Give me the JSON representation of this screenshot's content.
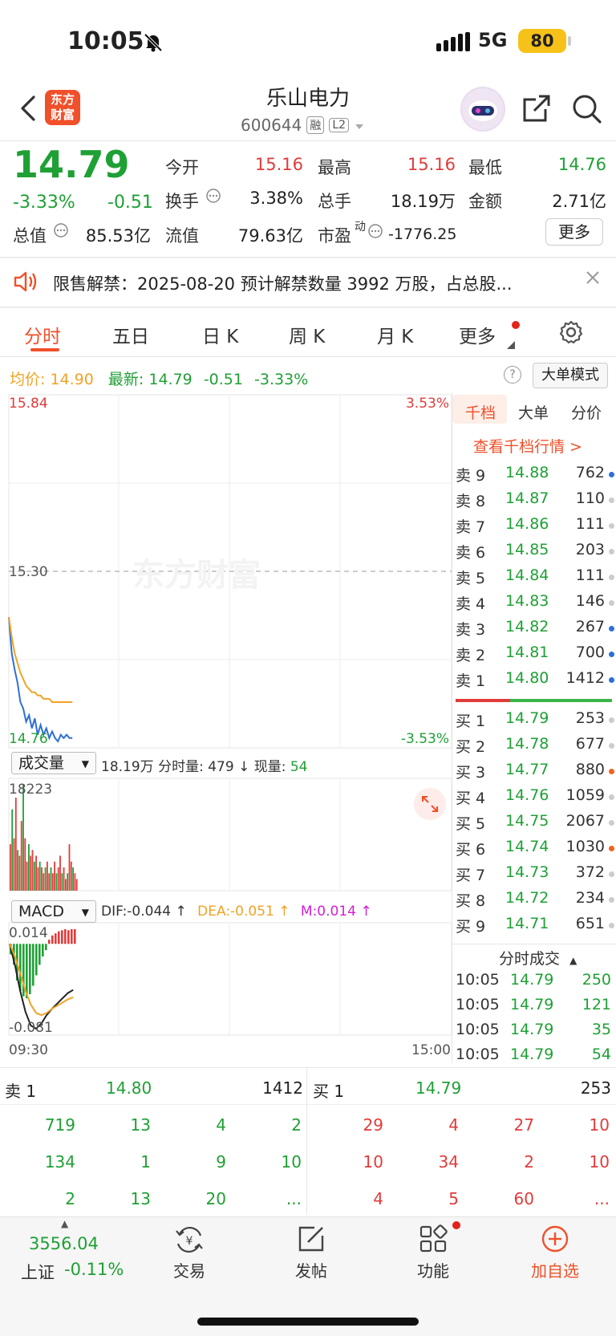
{
  "status_bar": {
    "time": "10:05",
    "network": "5G",
    "battery": "80"
  },
  "header": {
    "logo_line1": "东方",
    "logo_line2": "财富",
    "title": "乐山电力",
    "code": "600644",
    "tag_margin": "融",
    "tag_level": "L2"
  },
  "quote": {
    "price": "14.79",
    "pct": "-3.33%",
    "change": "-0.51",
    "open_label": "今开",
    "open": "15.16",
    "high_label": "最高",
    "high": "15.16",
    "low_label": "最低",
    "low": "14.76",
    "turnover_label": "换手",
    "turnover": "3.38%",
    "volume_label": "总手",
    "volume": "18.19万",
    "amount_label": "金额",
    "amount": "2.71亿",
    "mktcap_label": "总值",
    "mktcap": "85.53亿",
    "float_label": "流值",
    "float": "79.63亿",
    "pe_label": "市盈",
    "pe_sup": "动",
    "pe": "-1776.25",
    "more": "更多"
  },
  "notice": {
    "text": "限售解禁：2025-08-20 预计解禁数量 3992 万股，占总股..."
  },
  "tabs": [
    "分时",
    "五日",
    "日 K",
    "周 K",
    "月 K",
    "更多"
  ],
  "chart_header": {
    "avg_label": "均价:",
    "avg": "14.90",
    "latest_label": "最新:",
    "latest": "14.79",
    "latest_chg": "-0.51",
    "latest_pct": "-3.33%",
    "help": "?",
    "big_mode": "大单模式"
  },
  "chart_data": [
    {
      "type": "line",
      "panel": "分时",
      "x_start": "09:30",
      "x_end": "15:00",
      "y_max_label": "15.84",
      "y_mid_label": "15.30",
      "y_min_label": "14.76",
      "pct_max_label": "3.53%",
      "pct_min_label": "-3.53%",
      "ylim": [
        14.76,
        15.84
      ],
      "watermark": "东方财富",
      "series": [
        {
          "color": "#2f6fd6",
          "values": [
            15.16,
            15.05,
            15.0,
            14.96,
            14.9,
            14.88,
            14.84,
            14.86,
            14.82,
            14.85,
            14.8,
            14.83,
            14.8,
            14.82,
            14.79,
            14.81,
            14.79,
            14.78,
            14.8,
            14.79,
            14.8,
            14.79,
            14.79
          ]
        },
        {
          "color": "#f1a325",
          "values": [
            15.16,
            15.1,
            15.05,
            15.02,
            14.99,
            14.97,
            14.95,
            14.94,
            14.93,
            14.93,
            14.92,
            14.92,
            14.91,
            14.91,
            14.91,
            14.9,
            14.9,
            14.9,
            14.9,
            14.9,
            14.9,
            14.9,
            14.9
          ]
        }
      ]
    },
    {
      "type": "bar",
      "panel": "成交量",
      "label": "成交量",
      "summary": "18.19万 分时量: 479",
      "arrow": "↓",
      "now_label": "现量:",
      "now": "54",
      "y_max_label": "18223",
      "ylim": [
        0,
        18223
      ],
      "values": [
        8000,
        14000,
        9000,
        16000,
        7000,
        6000,
        12000,
        18223,
        9000,
        5000,
        8000,
        6000,
        7000,
        5000,
        6000,
        4000,
        5000,
        4000,
        3000,
        4000,
        5000,
        3000,
        4000,
        3000,
        5000,
        3000,
        4000,
        6000,
        3000,
        4000,
        2000,
        3000,
        8000,
        5000,
        4000,
        3000,
        2000
      ]
    },
    {
      "type": "line",
      "panel": "MACD",
      "label": "MACD",
      "dif": "DIF:-0.044 ↑",
      "dea": "DEA:-0.051 ↑",
      "m": "M:0.014 ↑",
      "y_max_label": "0.014",
      "y_min_label": "-0.081",
      "ylim": [
        -0.081,
        0.014
      ],
      "series": [
        {
          "name": "DIF",
          "color": "#222222",
          "values": [
            0.0,
            -0.02,
            -0.045,
            -0.065,
            -0.078,
            -0.081,
            -0.076,
            -0.068,
            -0.062,
            -0.057,
            -0.052,
            -0.047,
            -0.044
          ]
        },
        {
          "name": "DEA",
          "color": "#f1a325",
          "values": [
            0.0,
            -0.012,
            -0.028,
            -0.045,
            -0.058,
            -0.066,
            -0.068,
            -0.066,
            -0.062,
            -0.059,
            -0.056,
            -0.053,
            -0.051
          ]
        }
      ],
      "bars": [
        -0.01,
        -0.02,
        -0.035,
        -0.045,
        -0.05,
        -0.052,
        -0.048,
        -0.04,
        -0.03,
        -0.02,
        -0.012,
        -0.006,
        0.004,
        0.008,
        0.01,
        0.012,
        0.013,
        0.014,
        0.013,
        0.014,
        0.014
      ]
    }
  ],
  "orderbook": {
    "tabs": [
      "千档",
      "大单",
      "分价"
    ],
    "link": "查看千档行情 >",
    "asks": [
      {
        "label": "卖 9",
        "price": "14.88",
        "vol": "762",
        "dot": "#2f6fd6"
      },
      {
        "label": "卖 8",
        "price": "14.87",
        "vol": "110",
        "dot": "#cccccc"
      },
      {
        "label": "卖 7",
        "price": "14.86",
        "vol": "111",
        "dot": "#cccccc"
      },
      {
        "label": "卖 6",
        "price": "14.85",
        "vol": "203",
        "dot": "#cccccc"
      },
      {
        "label": "卖 5",
        "price": "14.84",
        "vol": "111",
        "dot": "#cccccc"
      },
      {
        "label": "卖 4",
        "price": "14.83",
        "vol": "146",
        "dot": "#cccccc"
      },
      {
        "label": "卖 3",
        "price": "14.82",
        "vol": "267",
        "dot": "#2f6fd6"
      },
      {
        "label": "卖 2",
        "price": "14.81",
        "vol": "700",
        "dot": "#2f6fd6"
      },
      {
        "label": "卖 1",
        "price": "14.80",
        "vol": "1412",
        "dot": "#2f6fd6"
      }
    ],
    "bids": [
      {
        "label": "买 1",
        "price": "14.79",
        "vol": "253",
        "dot": "#cccccc"
      },
      {
        "label": "买 2",
        "price": "14.78",
        "vol": "677",
        "dot": "#cccccc"
      },
      {
        "label": "买 3",
        "price": "14.77",
        "vol": "880",
        "dot": "#f0641e"
      },
      {
        "label": "买 4",
        "price": "14.76",
        "vol": "1059",
        "dot": "#cccccc"
      },
      {
        "label": "买 5",
        "price": "14.75",
        "vol": "2067",
        "dot": "#cccccc"
      },
      {
        "label": "买 6",
        "price": "14.74",
        "vol": "1030",
        "dot": "#f0641e"
      },
      {
        "label": "买 7",
        "price": "14.73",
        "vol": "372",
        "dot": "#cccccc"
      },
      {
        "label": "买 8",
        "price": "14.72",
        "vol": "234",
        "dot": "#cccccc"
      },
      {
        "label": "买 9",
        "price": "14.71",
        "vol": "651",
        "dot": "#cccccc"
      }
    ],
    "ticks_title": "分时成交",
    "ticks": [
      {
        "time": "10:05",
        "price": "14.79",
        "vol": "250"
      },
      {
        "time": "10:05",
        "price": "14.79",
        "vol": "121"
      },
      {
        "time": "10:05",
        "price": "14.79",
        "vol": "35"
      },
      {
        "time": "10:05",
        "price": "14.79",
        "vol": "54"
      }
    ]
  },
  "bottom_panel": {
    "ask_label": "卖 1",
    "ask_price": "14.80",
    "ask_vol": "1412",
    "bid_label": "买 1",
    "bid_price": "14.79",
    "bid_vol": "253",
    "ask_queue": [
      [
        "719",
        "13",
        "4",
        "2"
      ],
      [
        "134",
        "1",
        "9",
        "10"
      ],
      [
        "2",
        "13",
        "20",
        "..."
      ]
    ],
    "bid_queue": [
      [
        "29",
        "4",
        "27",
        "10"
      ],
      [
        "10",
        "34",
        "2",
        "10"
      ],
      [
        "4",
        "5",
        "60",
        "..."
      ]
    ]
  },
  "tab_bar": {
    "index_value": "3556.04",
    "index_name": "上证",
    "index_pct": "-0.11%",
    "trade": "交易",
    "post": "发帖",
    "functions": "功能",
    "add_watch": "加自选"
  },
  "colors": {
    "up": "#e23b3b",
    "down": "#1fa035",
    "accent": "#f0502a",
    "avg_line": "#f1a325",
    "price_line": "#2f6fd6"
  }
}
